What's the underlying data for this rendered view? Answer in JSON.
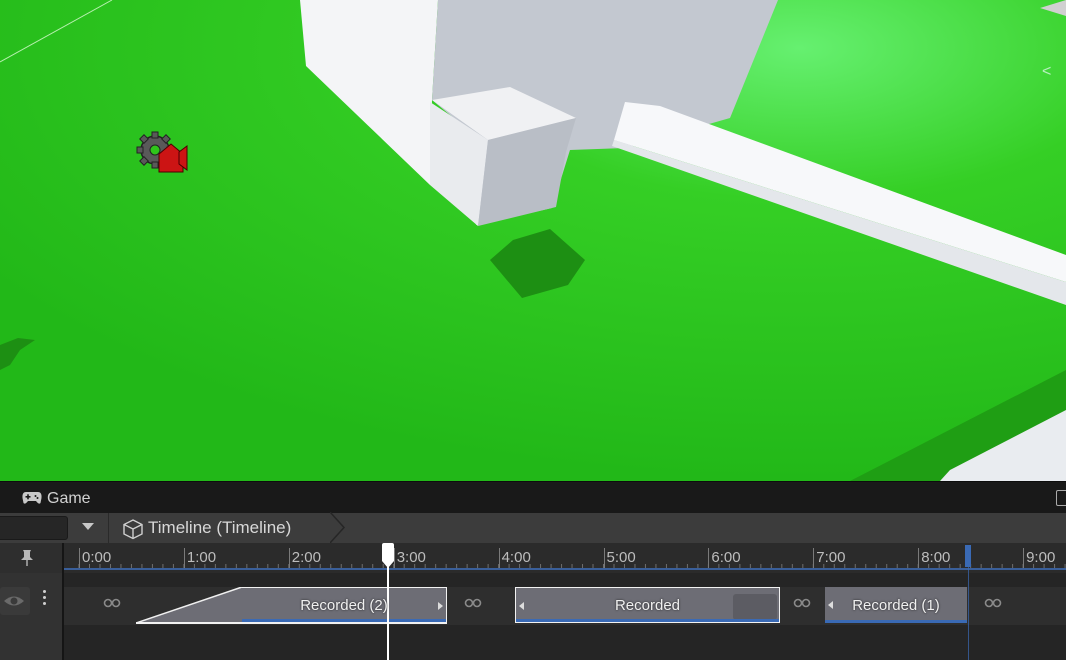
{
  "game_tab": {
    "label": "Game",
    "icon": "gamepad-icon"
  },
  "timeline": {
    "breadcrumb": "Timeline (Timeline)",
    "time_marks": [
      "0:00",
      "1:00",
      "2:00",
      "3:00",
      "4:00",
      "5:00",
      "6:00",
      "7:00",
      "8:00",
      "9:00"
    ],
    "clips": [
      {
        "label": "Recorded (2)"
      },
      {
        "label": "Recorded"
      },
      {
        "label": "Recorded (1)"
      }
    ]
  },
  "colors": {
    "ground": "#2fc41a",
    "clip": "#6d6d75",
    "clip_bar": "#3a6ab5",
    "panel_bg": "#282828"
  },
  "icons": [
    "camera-gear-icon",
    "gamepad-icon",
    "cube-icon",
    "pin-icon",
    "eye-icon",
    "more-icon",
    "link-icon",
    "playhead-icon"
  ]
}
